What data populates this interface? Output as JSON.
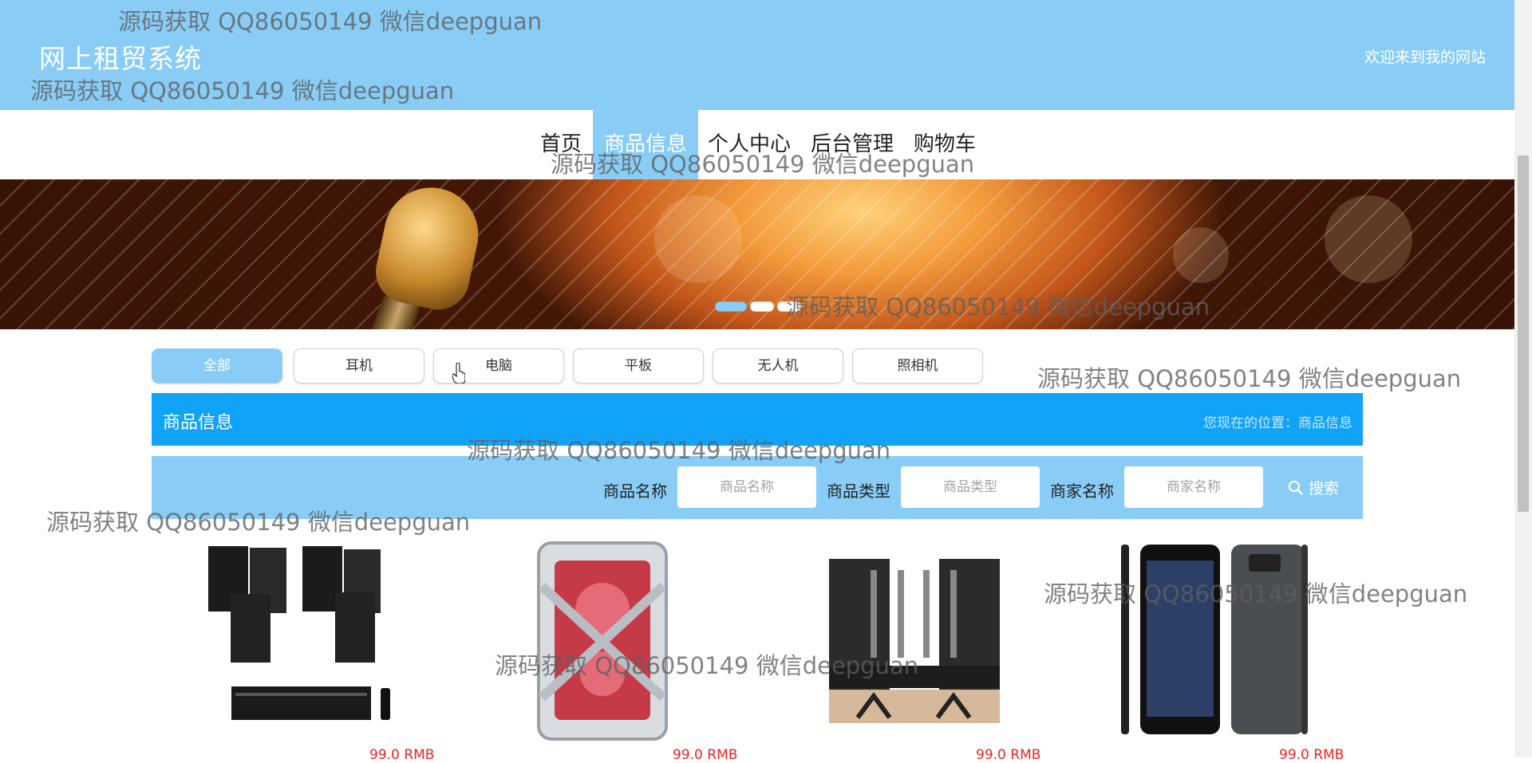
{
  "header": {
    "site_title": "网上租贸系统",
    "welcome": "欢迎来到我的网站"
  },
  "nav": {
    "items": [
      "首页",
      "商品信息",
      "个人中心",
      "后台管理",
      "购物车"
    ],
    "active_index": 1
  },
  "banner": {
    "slides": 3,
    "active_slide": 0
  },
  "categories": {
    "items": [
      "全部",
      "耳机",
      "电脑",
      "平板",
      "无人机",
      "照相机"
    ],
    "active_index": 0
  },
  "section": {
    "title": "商品信息",
    "breadcrumb": "您现在的位置：商品信息"
  },
  "search": {
    "name_label": "商品名称",
    "name_placeholder": "商品名称",
    "type_label": "商品类型",
    "type_placeholder": "商品类型",
    "merchant_label": "商家名称",
    "merchant_placeholder": "商家名称",
    "button_label": "搜索",
    "button_icon": "search-icon"
  },
  "products": [
    {
      "image": "speaker-system",
      "price": "99.0 RMB"
    },
    {
      "image": "gaming-pc-case",
      "price": "99.0 RMB"
    },
    {
      "image": "karaoke-speaker-set",
      "price": "99.0 RMB"
    },
    {
      "image": "smartphone",
      "price": "99.0 RMB"
    }
  ],
  "watermark": "源码获取 QQ86050149 微信deepguan",
  "colors": {
    "header_bg": "#89cdf7",
    "section_bg": "#11a3f8",
    "price": "#e22222"
  }
}
